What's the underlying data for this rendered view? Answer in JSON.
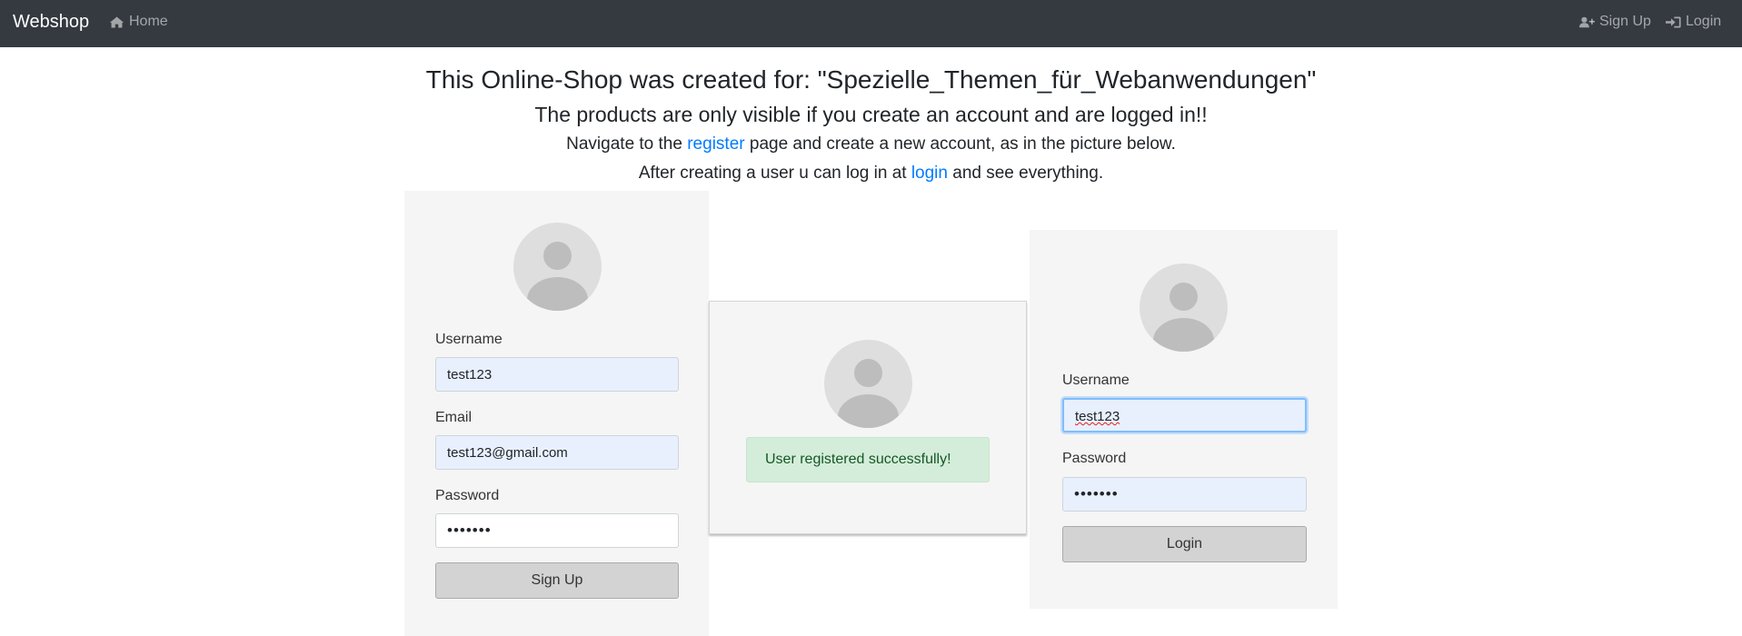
{
  "navbar": {
    "brand": "Webshop",
    "home_label": "Home",
    "signup_label": "Sign Up",
    "login_label": "Login",
    "icons": {
      "home": "home-icon",
      "signup": "user-plus-icon",
      "login": "sign-in-icon"
    }
  },
  "intro": {
    "title": "This Online-Shop was created for: \"Spezielle_Themen_für_Webanwendungen\"",
    "subtitle": "The products are only visible if you create an account and are logged in!!",
    "line1_before": "Navigate to the ",
    "line1_link": "register",
    "line1_after": " page and create a new account, as in the picture below.",
    "line2_before": "After creating a user u can log in at ",
    "line2_link": "login",
    "line2_after": " and see everything."
  },
  "signup_form": {
    "username_label": "Username",
    "username_value": "test123",
    "email_label": "Email",
    "email_value": "test123@gmail.com",
    "password_label": "Password",
    "password_value": "•••••••",
    "submit_label": "Sign Up"
  },
  "success_panel": {
    "message": "User registered successfully!"
  },
  "login_form": {
    "username_label": "Username",
    "username_value": "test123",
    "password_label": "Password",
    "password_value": "•••••••",
    "submit_label": "Login"
  },
  "colors": {
    "navbar_bg": "#343a40",
    "link": "#007bff",
    "panel_bg": "#f5f5f5",
    "autofill_bg": "#e8f0fe",
    "success_bg": "#d4edda",
    "success_text": "#155724",
    "button_bg": "#d3d3d3"
  }
}
